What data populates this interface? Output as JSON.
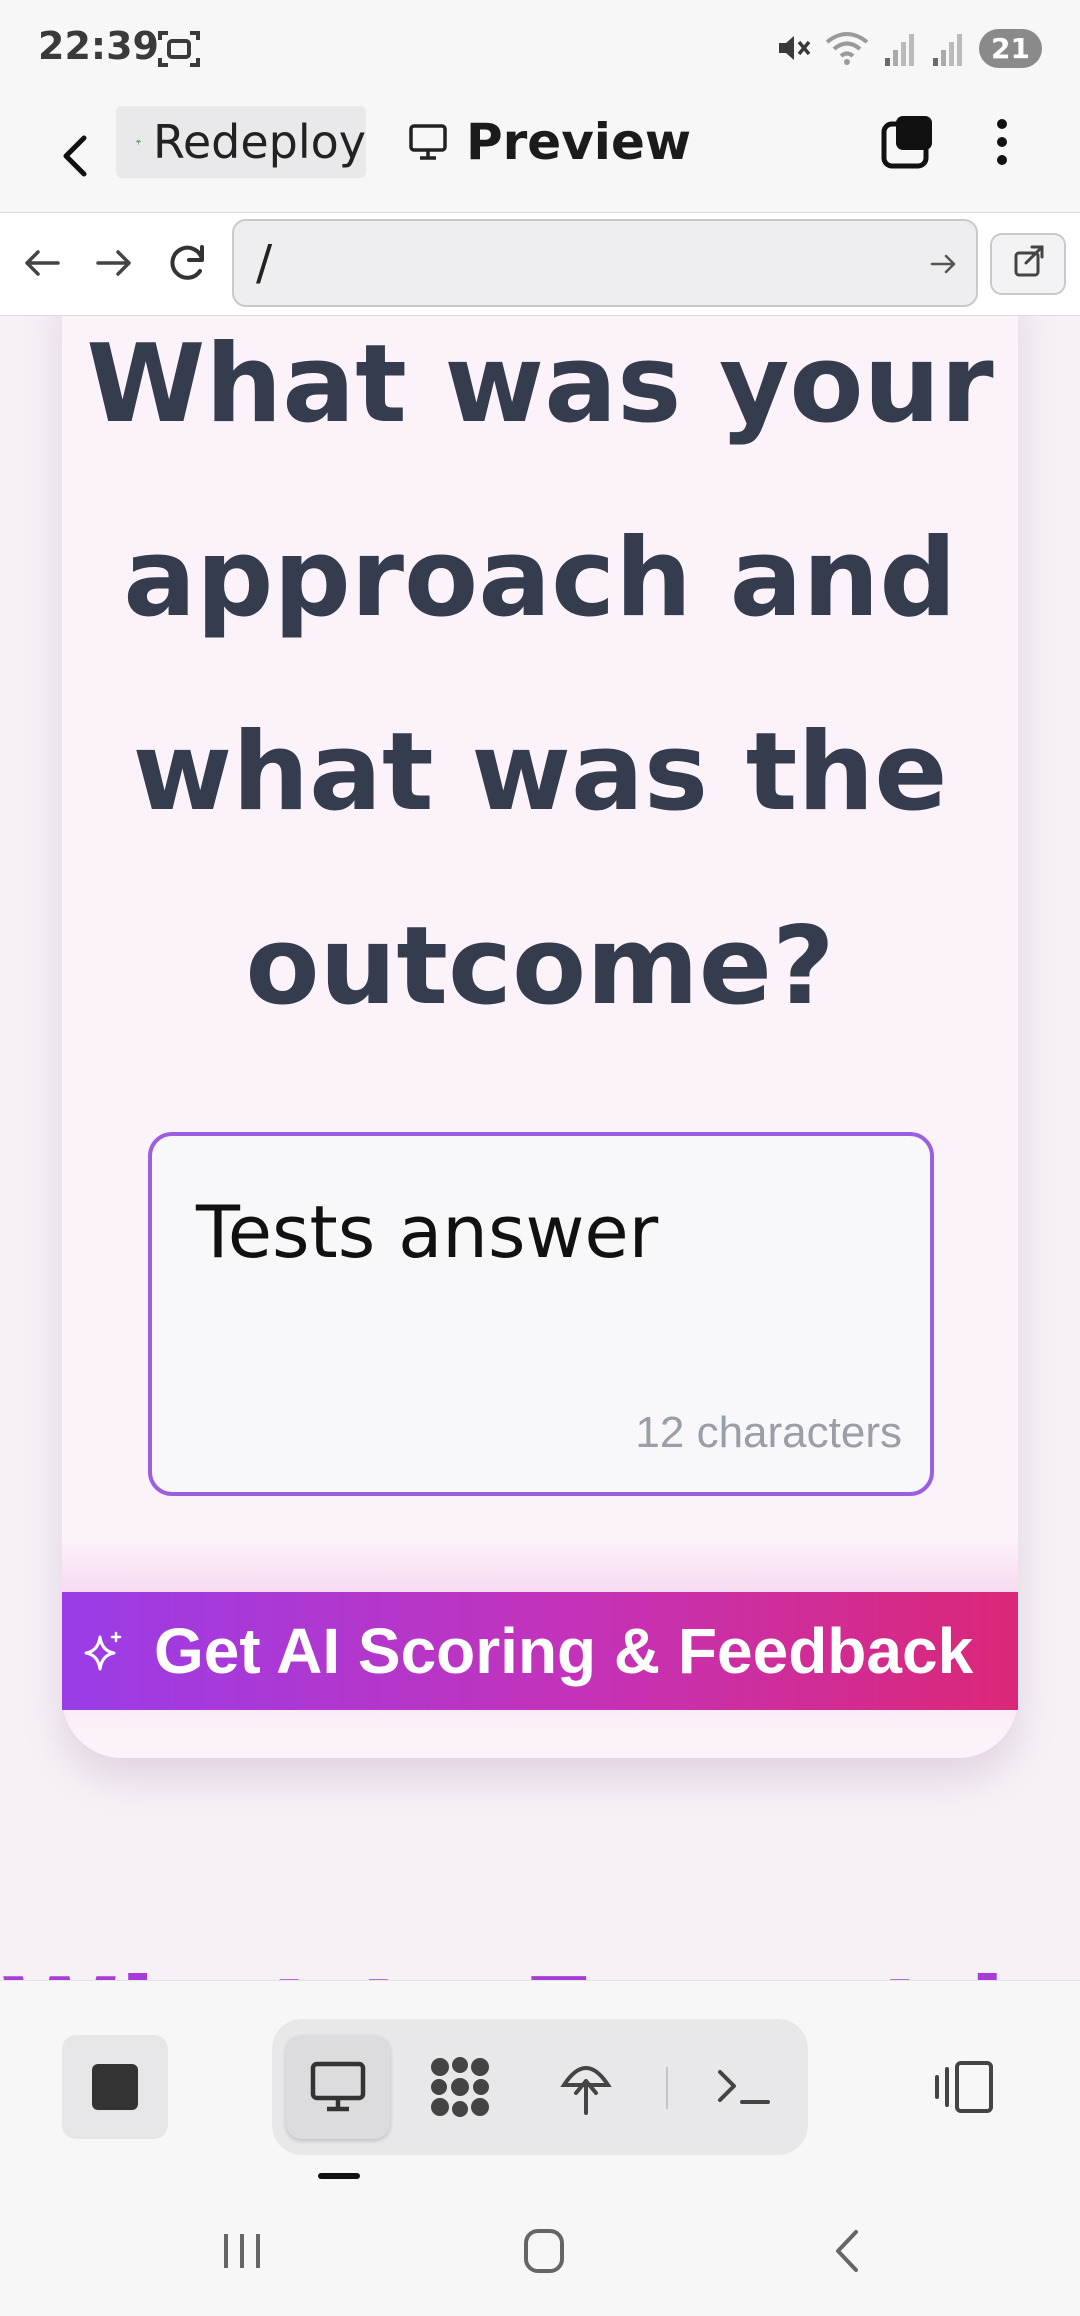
{
  "status_bar": {
    "time": "22:39",
    "battery": "21",
    "icons": [
      "screenshot-icon",
      "mute-icon",
      "wifi-icon",
      "signal-icon",
      "signal-icon"
    ]
  },
  "app_bar": {
    "repl_name": "Redeploy",
    "preview_label": "Preview"
  },
  "browser": {
    "url": "/"
  },
  "page": {
    "question": "What was your approach and what was the outcome?",
    "answer_value": "Tests answer",
    "char_count": "12 characters",
    "cta_label": "Get AI Scoring & Feedback",
    "next_heading": "What to Expect in"
  },
  "colors": {
    "heading": "#343c4d",
    "answer_border": "#9b5fe0",
    "cta_start": "#9a3de8",
    "cta_end": "#db2777",
    "section_heading": "#a83cd6"
  },
  "dock": {
    "tools": [
      "monitor-icon",
      "apps-icon",
      "deploy-icon",
      "terminal-icon"
    ]
  }
}
